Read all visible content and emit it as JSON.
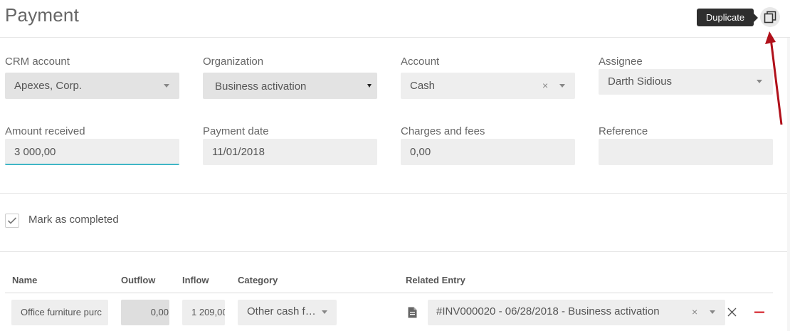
{
  "header": {
    "title": "Payment",
    "duplicate_tooltip": "Duplicate"
  },
  "fields": {
    "crm_account": {
      "label": "CRM account",
      "value": "Apexes, Corp."
    },
    "organization": {
      "label": "Organization",
      "value": "Business activation"
    },
    "account": {
      "label": "Account",
      "value": "Cash",
      "clear": "×"
    },
    "assignee": {
      "label": "Assignee",
      "value": "Darth Sidious"
    },
    "amount_received": {
      "label": "Amount received",
      "value": "3 000,00"
    },
    "payment_date": {
      "label": "Payment date",
      "value": "11/01/2018"
    },
    "charges_fees": {
      "label": "Charges and fees",
      "value": "0,00"
    },
    "reference": {
      "label": "Reference",
      "value": ""
    }
  },
  "mark_completed": {
    "label": "Mark as completed",
    "checked": true
  },
  "table": {
    "headers": [
      "Name",
      "Outflow",
      "Inflow",
      "Category",
      "Related Entry"
    ],
    "rows": [
      {
        "name": "Office furniture purc",
        "outflow": "0,00",
        "inflow": "1 209,00",
        "category": "Other cash f…",
        "related_entry": "#INV000020 - 06/28/2018 - Business activation",
        "clear": "×"
      }
    ]
  },
  "icons": [
    "duplicate-icon",
    "checkmark-icon",
    "document-icon",
    "close-icon",
    "minus-icon",
    "chevron-down-icon"
  ],
  "colors": {
    "accent": "#3fb6c6",
    "remove": "#d9373f",
    "annotation_arrow": "#b0101a"
  }
}
